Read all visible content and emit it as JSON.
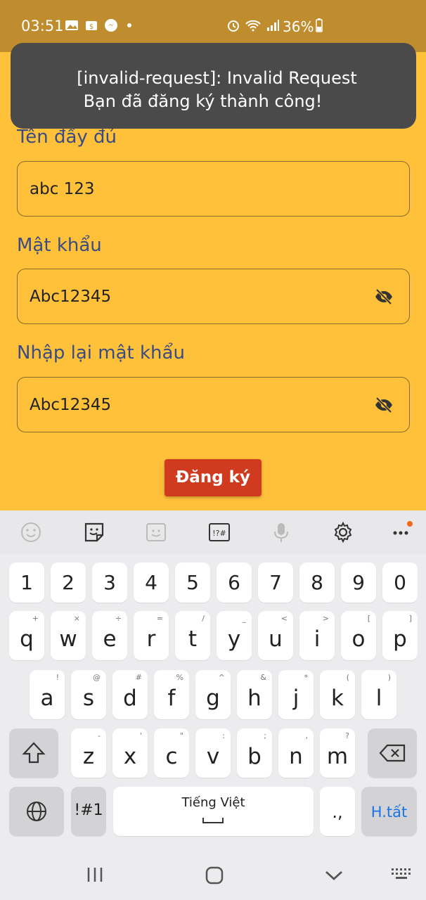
{
  "status_bar": {
    "time": "03:51",
    "battery": "36%",
    "icons": [
      "gallery-icon",
      "store-icon",
      "messenger-icon",
      "dot-icon",
      "alarm-icon",
      "wifi-icon",
      "signal-icon",
      "battery-icon"
    ]
  },
  "toast": {
    "line1": "[invalid-request]: Invalid Request",
    "line2": "Bạn đã đăng ký thành công!"
  },
  "form": {
    "fullname_label": "Tên đầy đủ",
    "fullname_value": "abc 123",
    "password_label": "Mật khẩu",
    "password_value": "Abc12345",
    "confirm_label": "Nhập lại mật khẩu",
    "confirm_value": "Abc12345",
    "submit_label": "Đăng ký"
  },
  "keyboard": {
    "toolbar": [
      "emoji-icon",
      "sticker-icon",
      "bitmoji-icon",
      "symbols-icon",
      "mic-icon",
      "settings-icon",
      "more-icon"
    ],
    "numbers": [
      "1",
      "2",
      "3",
      "4",
      "5",
      "6",
      "7",
      "8",
      "9",
      "0"
    ],
    "row1": [
      {
        "k": "q",
        "s": "+"
      },
      {
        "k": "w",
        "s": "×"
      },
      {
        "k": "e",
        "s": "÷"
      },
      {
        "k": "r",
        "s": "="
      },
      {
        "k": "t",
        "s": "/"
      },
      {
        "k": "y",
        "s": "_"
      },
      {
        "k": "u",
        "s": "<"
      },
      {
        "k": "i",
        "s": ">"
      },
      {
        "k": "o",
        "s": "["
      },
      {
        "k": "p",
        "s": "]"
      }
    ],
    "row2": [
      {
        "k": "a",
        "s": "!"
      },
      {
        "k": "s",
        "s": "@"
      },
      {
        "k": "d",
        "s": "#"
      },
      {
        "k": "f",
        "s": "%"
      },
      {
        "k": "g",
        "s": "^"
      },
      {
        "k": "h",
        "s": "&"
      },
      {
        "k": "j",
        "s": "*"
      },
      {
        "k": "k",
        "s": "("
      },
      {
        "k": "l",
        "s": ")"
      }
    ],
    "row3": [
      {
        "k": "z",
        "s": "-"
      },
      {
        "k": "x",
        "s": "'"
      },
      {
        "k": "c",
        "s": "\""
      },
      {
        "k": "v",
        "s": ":"
      },
      {
        "k": "b",
        "s": ";"
      },
      {
        "k": "n",
        "s": ","
      },
      {
        "k": "m",
        "s": "?"
      }
    ],
    "sym_key": "!#1",
    "space_label": "Tiếng Việt",
    "punct_key": ".,",
    "done_key": "H.tất",
    "accent": "#1a73e8"
  },
  "navbar": {
    "icons": [
      "recent-apps-icon",
      "home-icon",
      "back-icon",
      "keyboard-switch-icon"
    ]
  }
}
